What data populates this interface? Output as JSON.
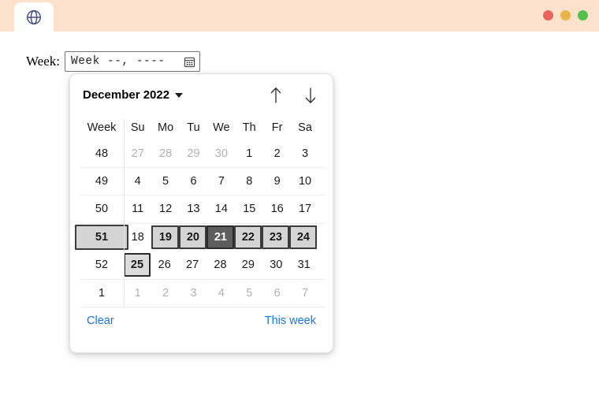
{
  "window": {
    "tab_icon": "globe-icon",
    "controls": [
      {
        "name": "close",
        "color": "#e8635c"
      },
      {
        "name": "minimize",
        "color": "#e8b44a"
      },
      {
        "name": "maximize",
        "color": "#54c04a"
      }
    ],
    "titlebar_color": "#fce1cd"
  },
  "form": {
    "label": "Week:",
    "input_value": "Week --, ----",
    "input_placeholder": "Week --, ----",
    "picker_icon": "calendar-icon"
  },
  "calendar": {
    "month_label": "December 2022",
    "caret_icon": "chevron-down-icon",
    "prev_icon": "arrow-up-icon",
    "next_icon": "arrow-down-icon",
    "columns": [
      "Week",
      "Su",
      "Mo",
      "Tu",
      "We",
      "Th",
      "Fr",
      "Sa"
    ],
    "rows": [
      {
        "week": "48",
        "week_state": "normal",
        "days": [
          {
            "label": "27",
            "state": "muted"
          },
          {
            "label": "28",
            "state": "muted"
          },
          {
            "label": "29",
            "state": "muted"
          },
          {
            "label": "30",
            "state": "muted"
          },
          {
            "label": "1",
            "state": "normal"
          },
          {
            "label": "2",
            "state": "normal"
          },
          {
            "label": "3",
            "state": "normal"
          }
        ]
      },
      {
        "week": "49",
        "week_state": "normal",
        "days": [
          {
            "label": "4",
            "state": "normal"
          },
          {
            "label": "5",
            "state": "normal"
          },
          {
            "label": "6",
            "state": "normal"
          },
          {
            "label": "7",
            "state": "normal"
          },
          {
            "label": "8",
            "state": "normal"
          },
          {
            "label": "9",
            "state": "normal"
          },
          {
            "label": "10",
            "state": "normal"
          }
        ]
      },
      {
        "week": "50",
        "week_state": "normal",
        "days": [
          {
            "label": "11",
            "state": "normal"
          },
          {
            "label": "12",
            "state": "normal"
          },
          {
            "label": "13",
            "state": "normal"
          },
          {
            "label": "14",
            "state": "normal"
          },
          {
            "label": "15",
            "state": "normal"
          },
          {
            "label": "16",
            "state": "normal"
          },
          {
            "label": "17",
            "state": "normal"
          }
        ]
      },
      {
        "week": "51",
        "week_state": "selected",
        "days": [
          {
            "label": "18",
            "state": "normal"
          },
          {
            "label": "19",
            "state": "highlighted"
          },
          {
            "label": "20",
            "state": "highlighted"
          },
          {
            "label": "21",
            "state": "focused"
          },
          {
            "label": "22",
            "state": "highlighted"
          },
          {
            "label": "23",
            "state": "highlighted"
          },
          {
            "label": "24",
            "state": "highlighted"
          }
        ]
      },
      {
        "week": "52",
        "week_state": "normal",
        "days": [
          {
            "label": "25",
            "state": "today"
          },
          {
            "label": "26",
            "state": "normal"
          },
          {
            "label": "27",
            "state": "normal"
          },
          {
            "label": "28",
            "state": "normal"
          },
          {
            "label": "29",
            "state": "normal"
          },
          {
            "label": "30",
            "state": "normal"
          },
          {
            "label": "31",
            "state": "normal"
          }
        ]
      },
      {
        "week": "1",
        "week_state": "normal",
        "days": [
          {
            "label": "1",
            "state": "muted"
          },
          {
            "label": "2",
            "state": "muted"
          },
          {
            "label": "3",
            "state": "muted"
          },
          {
            "label": "4",
            "state": "muted"
          },
          {
            "label": "5",
            "state": "muted"
          },
          {
            "label": "6",
            "state": "muted"
          },
          {
            "label": "7",
            "state": "muted"
          }
        ]
      }
    ],
    "footer": {
      "clear_label": "Clear",
      "this_week_label": "This week",
      "link_color": "#1a73e8"
    }
  }
}
